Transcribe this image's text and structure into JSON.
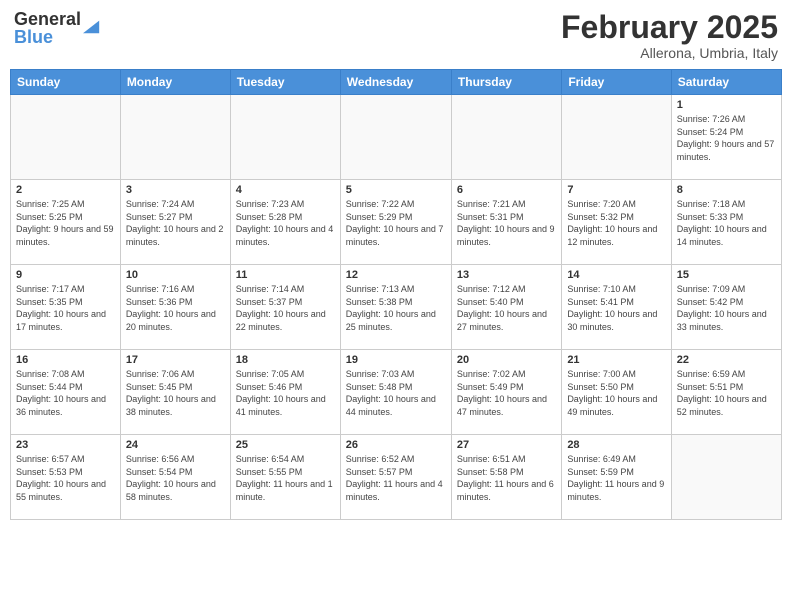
{
  "header": {
    "logo_general": "General",
    "logo_blue": "Blue",
    "month_title": "February 2025",
    "location": "Allerona, Umbria, Italy"
  },
  "weekdays": [
    "Sunday",
    "Monday",
    "Tuesday",
    "Wednesday",
    "Thursday",
    "Friday",
    "Saturday"
  ],
  "weeks": [
    [
      {
        "day": "",
        "info": ""
      },
      {
        "day": "",
        "info": ""
      },
      {
        "day": "",
        "info": ""
      },
      {
        "day": "",
        "info": ""
      },
      {
        "day": "",
        "info": ""
      },
      {
        "day": "",
        "info": ""
      },
      {
        "day": "1",
        "info": "Sunrise: 7:26 AM\nSunset: 5:24 PM\nDaylight: 9 hours and 57 minutes."
      }
    ],
    [
      {
        "day": "2",
        "info": "Sunrise: 7:25 AM\nSunset: 5:25 PM\nDaylight: 9 hours and 59 minutes."
      },
      {
        "day": "3",
        "info": "Sunrise: 7:24 AM\nSunset: 5:27 PM\nDaylight: 10 hours and 2 minutes."
      },
      {
        "day": "4",
        "info": "Sunrise: 7:23 AM\nSunset: 5:28 PM\nDaylight: 10 hours and 4 minutes."
      },
      {
        "day": "5",
        "info": "Sunrise: 7:22 AM\nSunset: 5:29 PM\nDaylight: 10 hours and 7 minutes."
      },
      {
        "day": "6",
        "info": "Sunrise: 7:21 AM\nSunset: 5:31 PM\nDaylight: 10 hours and 9 minutes."
      },
      {
        "day": "7",
        "info": "Sunrise: 7:20 AM\nSunset: 5:32 PM\nDaylight: 10 hours and 12 minutes."
      },
      {
        "day": "8",
        "info": "Sunrise: 7:18 AM\nSunset: 5:33 PM\nDaylight: 10 hours and 14 minutes."
      }
    ],
    [
      {
        "day": "9",
        "info": "Sunrise: 7:17 AM\nSunset: 5:35 PM\nDaylight: 10 hours and 17 minutes."
      },
      {
        "day": "10",
        "info": "Sunrise: 7:16 AM\nSunset: 5:36 PM\nDaylight: 10 hours and 20 minutes."
      },
      {
        "day": "11",
        "info": "Sunrise: 7:14 AM\nSunset: 5:37 PM\nDaylight: 10 hours and 22 minutes."
      },
      {
        "day": "12",
        "info": "Sunrise: 7:13 AM\nSunset: 5:38 PM\nDaylight: 10 hours and 25 minutes."
      },
      {
        "day": "13",
        "info": "Sunrise: 7:12 AM\nSunset: 5:40 PM\nDaylight: 10 hours and 27 minutes."
      },
      {
        "day": "14",
        "info": "Sunrise: 7:10 AM\nSunset: 5:41 PM\nDaylight: 10 hours and 30 minutes."
      },
      {
        "day": "15",
        "info": "Sunrise: 7:09 AM\nSunset: 5:42 PM\nDaylight: 10 hours and 33 minutes."
      }
    ],
    [
      {
        "day": "16",
        "info": "Sunrise: 7:08 AM\nSunset: 5:44 PM\nDaylight: 10 hours and 36 minutes."
      },
      {
        "day": "17",
        "info": "Sunrise: 7:06 AM\nSunset: 5:45 PM\nDaylight: 10 hours and 38 minutes."
      },
      {
        "day": "18",
        "info": "Sunrise: 7:05 AM\nSunset: 5:46 PM\nDaylight: 10 hours and 41 minutes."
      },
      {
        "day": "19",
        "info": "Sunrise: 7:03 AM\nSunset: 5:48 PM\nDaylight: 10 hours and 44 minutes."
      },
      {
        "day": "20",
        "info": "Sunrise: 7:02 AM\nSunset: 5:49 PM\nDaylight: 10 hours and 47 minutes."
      },
      {
        "day": "21",
        "info": "Sunrise: 7:00 AM\nSunset: 5:50 PM\nDaylight: 10 hours and 49 minutes."
      },
      {
        "day": "22",
        "info": "Sunrise: 6:59 AM\nSunset: 5:51 PM\nDaylight: 10 hours and 52 minutes."
      }
    ],
    [
      {
        "day": "23",
        "info": "Sunrise: 6:57 AM\nSunset: 5:53 PM\nDaylight: 10 hours and 55 minutes."
      },
      {
        "day": "24",
        "info": "Sunrise: 6:56 AM\nSunset: 5:54 PM\nDaylight: 10 hours and 58 minutes."
      },
      {
        "day": "25",
        "info": "Sunrise: 6:54 AM\nSunset: 5:55 PM\nDaylight: 11 hours and 1 minute."
      },
      {
        "day": "26",
        "info": "Sunrise: 6:52 AM\nSunset: 5:57 PM\nDaylight: 11 hours and 4 minutes."
      },
      {
        "day": "27",
        "info": "Sunrise: 6:51 AM\nSunset: 5:58 PM\nDaylight: 11 hours and 6 minutes."
      },
      {
        "day": "28",
        "info": "Sunrise: 6:49 AM\nSunset: 5:59 PM\nDaylight: 11 hours and 9 minutes."
      },
      {
        "day": "",
        "info": ""
      }
    ]
  ]
}
